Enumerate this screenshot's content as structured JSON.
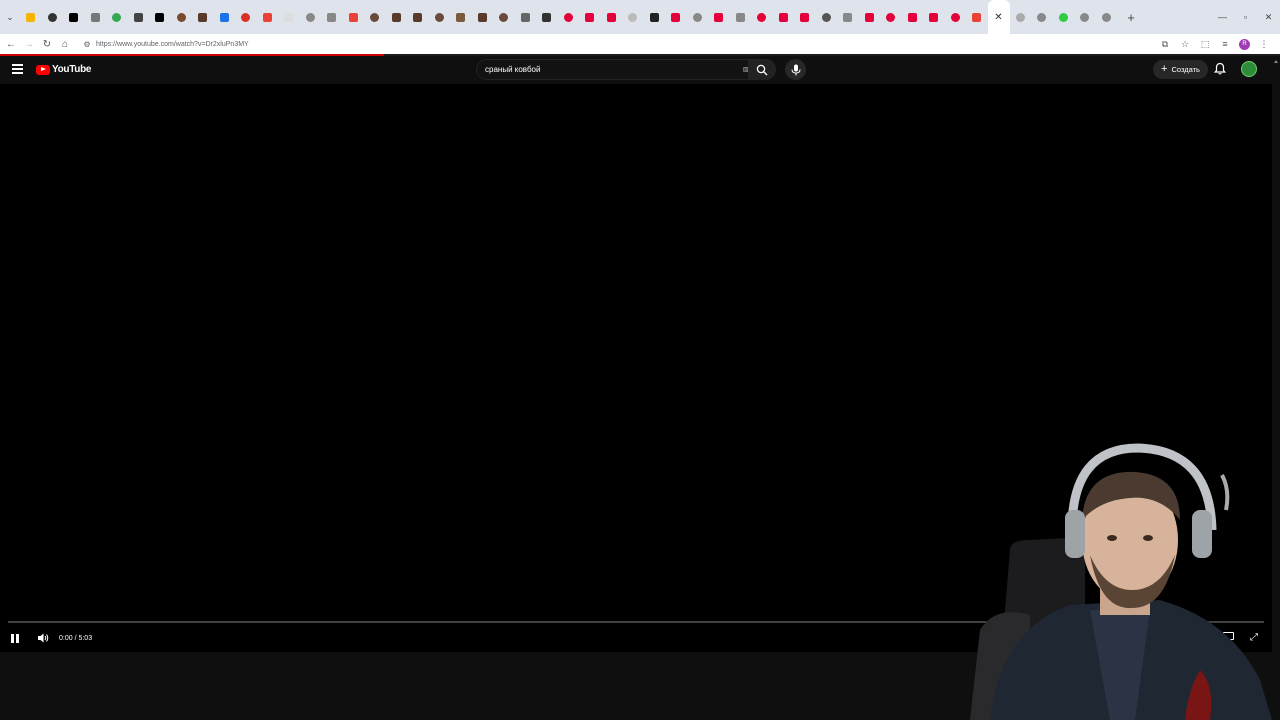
{
  "browser": {
    "tabs_favicon_colors": [
      "#f4b400",
      "#333333",
      "#000000",
      "#777777",
      "#34a853",
      "#444444",
      "#000000",
      "#7a4a2a",
      "#5a3a2a",
      "#1a73e8",
      "#d93025",
      "#ea4335",
      "#dddddd",
      "#888888",
      "#888888",
      "#ea4335",
      "#6a4a3a",
      "#5a3a2a",
      "#5a3a2a",
      "#6a4a3a",
      "#7a5a3a",
      "#5a3a2a",
      "#6a4a3a",
      "#666666",
      "#333333",
      "#e4003a",
      "#e4003a",
      "#e4003a",
      "#bbbbbb",
      "#222222",
      "#e4003a",
      "#888888",
      "#e4003a",
      "#888888",
      "#e4003a",
      "#e4003a",
      "#e4003a",
      "#555555",
      "#888888",
      "#e4003a",
      "#e4003a",
      "#e4003a",
      "#e4003a",
      "#e4003a",
      "#ea4335"
    ],
    "active_tab_close": "✕",
    "url": "https://www.youtube.com/watch?v=Dr2xluPn3MY",
    "profile_initial": "R",
    "load_progress": 0.3
  },
  "youtube": {
    "logo_text": "YouTube",
    "search_query": "сраный ковбой",
    "create_label": "Создать"
  },
  "player": {
    "time_display": "0:00 / 5:03",
    "progress_fraction": 0.0
  },
  "colors": {
    "brand_red": "#ff0000",
    "background": "#0f0f0f"
  }
}
